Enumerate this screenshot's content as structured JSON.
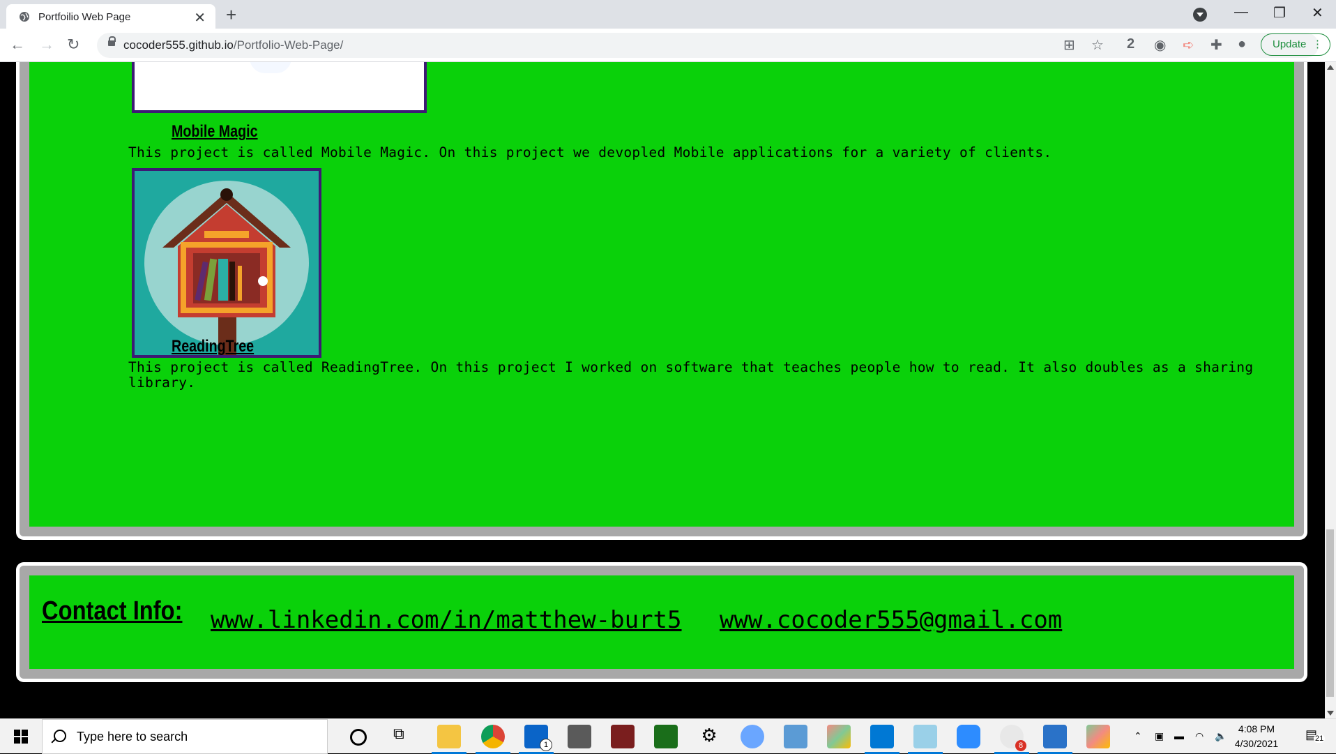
{
  "browser": {
    "tab_title": "Portfoilio Web Page",
    "url_domain": "cocoder555.github.io",
    "url_path": "/Portfolio-Web-Page/",
    "extension_badge": "2",
    "update_label": "Update"
  },
  "projects": [
    {
      "title": "Mobile Magic",
      "description": "This project is called Mobile Magic. On this project we devopled Mobile applications for a variety of clients."
    },
    {
      "title": "ReadingTree",
      "description": "This project is called ReadingTree. On this project I worked on software that teaches people how to read. It also doubles as a sharing library."
    }
  ],
  "contact": {
    "heading": "Contact Info:",
    "linkedin": "www.linkedin.com/in/matthew-burt5",
    "email": "www.cocoder555@gmail.com"
  },
  "taskbar": {
    "search_placeholder": "Type here to search",
    "time": "4:08 PM",
    "date": "4/30/2021",
    "mail_badge": "1",
    "slack_badge": "8",
    "notification_count": "21"
  },
  "colors": {
    "panel_green": "#0ad10a",
    "panel_border": "#a8a8a8",
    "image_border": "#3d1a74"
  }
}
